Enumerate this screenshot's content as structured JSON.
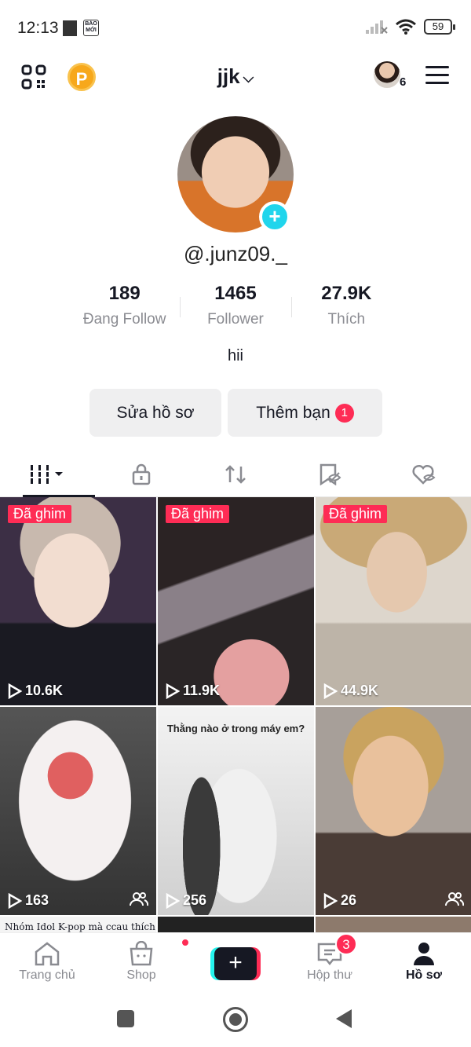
{
  "status_bar": {
    "time": "12:13",
    "notification_label": "BÁO MỚI",
    "battery": "59"
  },
  "header": {
    "username": "jjk",
    "coin_label": "P",
    "story_count": "6"
  },
  "profile": {
    "handle": "@.junz09._",
    "bio": "hii",
    "stats": [
      {
        "value": "189",
        "label": "Đang Follow"
      },
      {
        "value": "1465",
        "label": "Follower"
      },
      {
        "value": "27.9K",
        "label": "Thích"
      }
    ],
    "edit_label": "Sửa hồ sơ",
    "add_friends_label": "Thêm bạn",
    "add_friends_badge": "1"
  },
  "tabs": [
    "videos",
    "private",
    "reposts",
    "favorites",
    "liked"
  ],
  "videos": [
    {
      "pinned_label": "Đã ghim",
      "views": "10.6K",
      "friends_only": false,
      "caption": ""
    },
    {
      "pinned_label": "Đã ghim",
      "views": "11.9K",
      "friends_only": false,
      "caption": ""
    },
    {
      "pinned_label": "Đã ghim",
      "views": "44.9K",
      "friends_only": false,
      "caption": ""
    },
    {
      "pinned_label": "",
      "views": "163",
      "friends_only": true,
      "caption": ""
    },
    {
      "pinned_label": "",
      "views": "256",
      "friends_only": false,
      "caption": "Thằng nào ở trong máy em?"
    },
    {
      "pinned_label": "",
      "views": "26",
      "friends_only": true,
      "caption": ""
    }
  ],
  "partial_row_caption": "Nhóm Idol K-pop mà ccau thích",
  "bottom_nav": {
    "home": "Trang chủ",
    "shop": "Shop",
    "inbox": "Hộp thư",
    "inbox_badge": "3",
    "profile": "Hồ sơ"
  },
  "colors": {
    "accent_red": "#fe2c55",
    "accent_cyan": "#20d5ec",
    "text_primary": "#161823",
    "text_secondary": "#8a8b91"
  }
}
